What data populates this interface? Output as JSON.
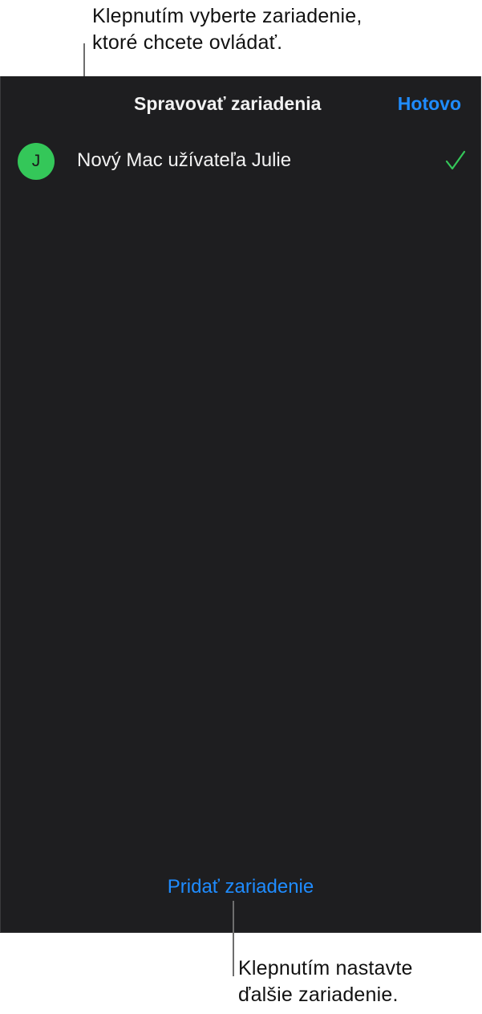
{
  "annotations": {
    "top": {
      "line1": "Klepnutím vyberte zariadenie,",
      "line2": "ktoré chcete ovládať."
    },
    "bottom": {
      "line1": "Klepnutím nastavte",
      "line2": "ďalšie zariadenie."
    }
  },
  "screen": {
    "title": "Spravovať zariadenia",
    "done_label": "Hotovo",
    "devices": [
      {
        "avatar_initial": "J",
        "name": "Nový Mac užívateľa Julie",
        "selected": true,
        "icon": "checkmark-icon"
      }
    ],
    "add_device_label": "Pridať zariadenie"
  },
  "colors": {
    "background": "#1e1e20",
    "accent": "#1f8cff",
    "avatar": "#34c759",
    "checkmark": "#34c759",
    "text": "#f2f2f2"
  }
}
